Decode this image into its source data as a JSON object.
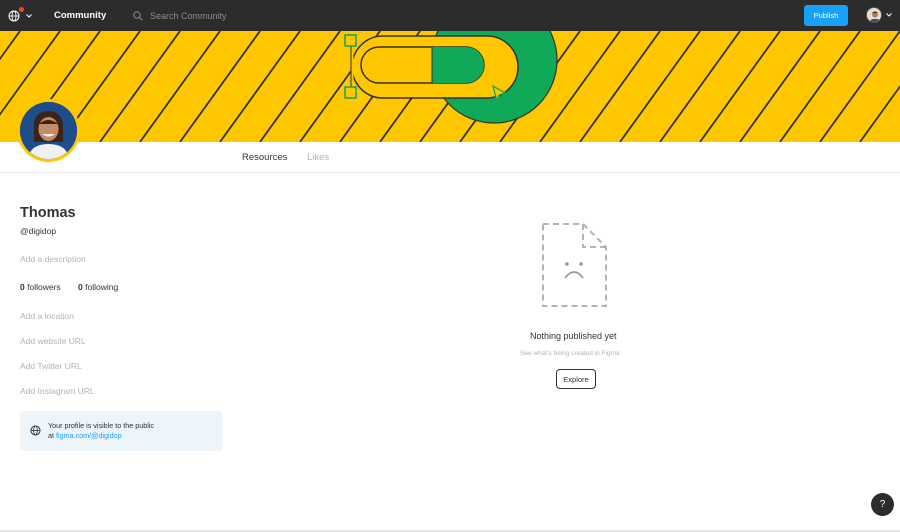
{
  "topbar": {
    "nav_label": "Community",
    "search_placeholder": "Search Community",
    "publish_label": "Publish",
    "icons": [
      "globe-icon",
      "chevron-down-icon",
      "search-icon",
      "avatar"
    ]
  },
  "tabs": [
    {
      "label": "Resources",
      "active": true
    },
    {
      "label": "Likes",
      "active": false
    }
  ],
  "profile": {
    "name": "Thomas",
    "handle": "@digidop",
    "add_description": "Add a description",
    "followers_count": "0",
    "followers_label": "followers",
    "following_count": "0",
    "following_label": "following",
    "add_location": "Add a location",
    "add_website": "Add website URL",
    "add_twitter": "Add Twitter URL",
    "add_instagram": "Add Instagram URL"
  },
  "notice": {
    "line1": "Your profile is visible to the public",
    "line2_prefix": "at",
    "link": "figma.com/@digidop"
  },
  "empty_state": {
    "title": "Nothing published yet",
    "subtitle": "See what’s being created in Figma",
    "button": "Explore"
  },
  "help": {
    "label": "?"
  },
  "colors": {
    "topbar": "#2c2c2c",
    "banner_yellow": "#ffc700",
    "banner_green": "#0fa958",
    "accent_blue": "#18a0fb",
    "notice_bg": "#edf4fa"
  }
}
